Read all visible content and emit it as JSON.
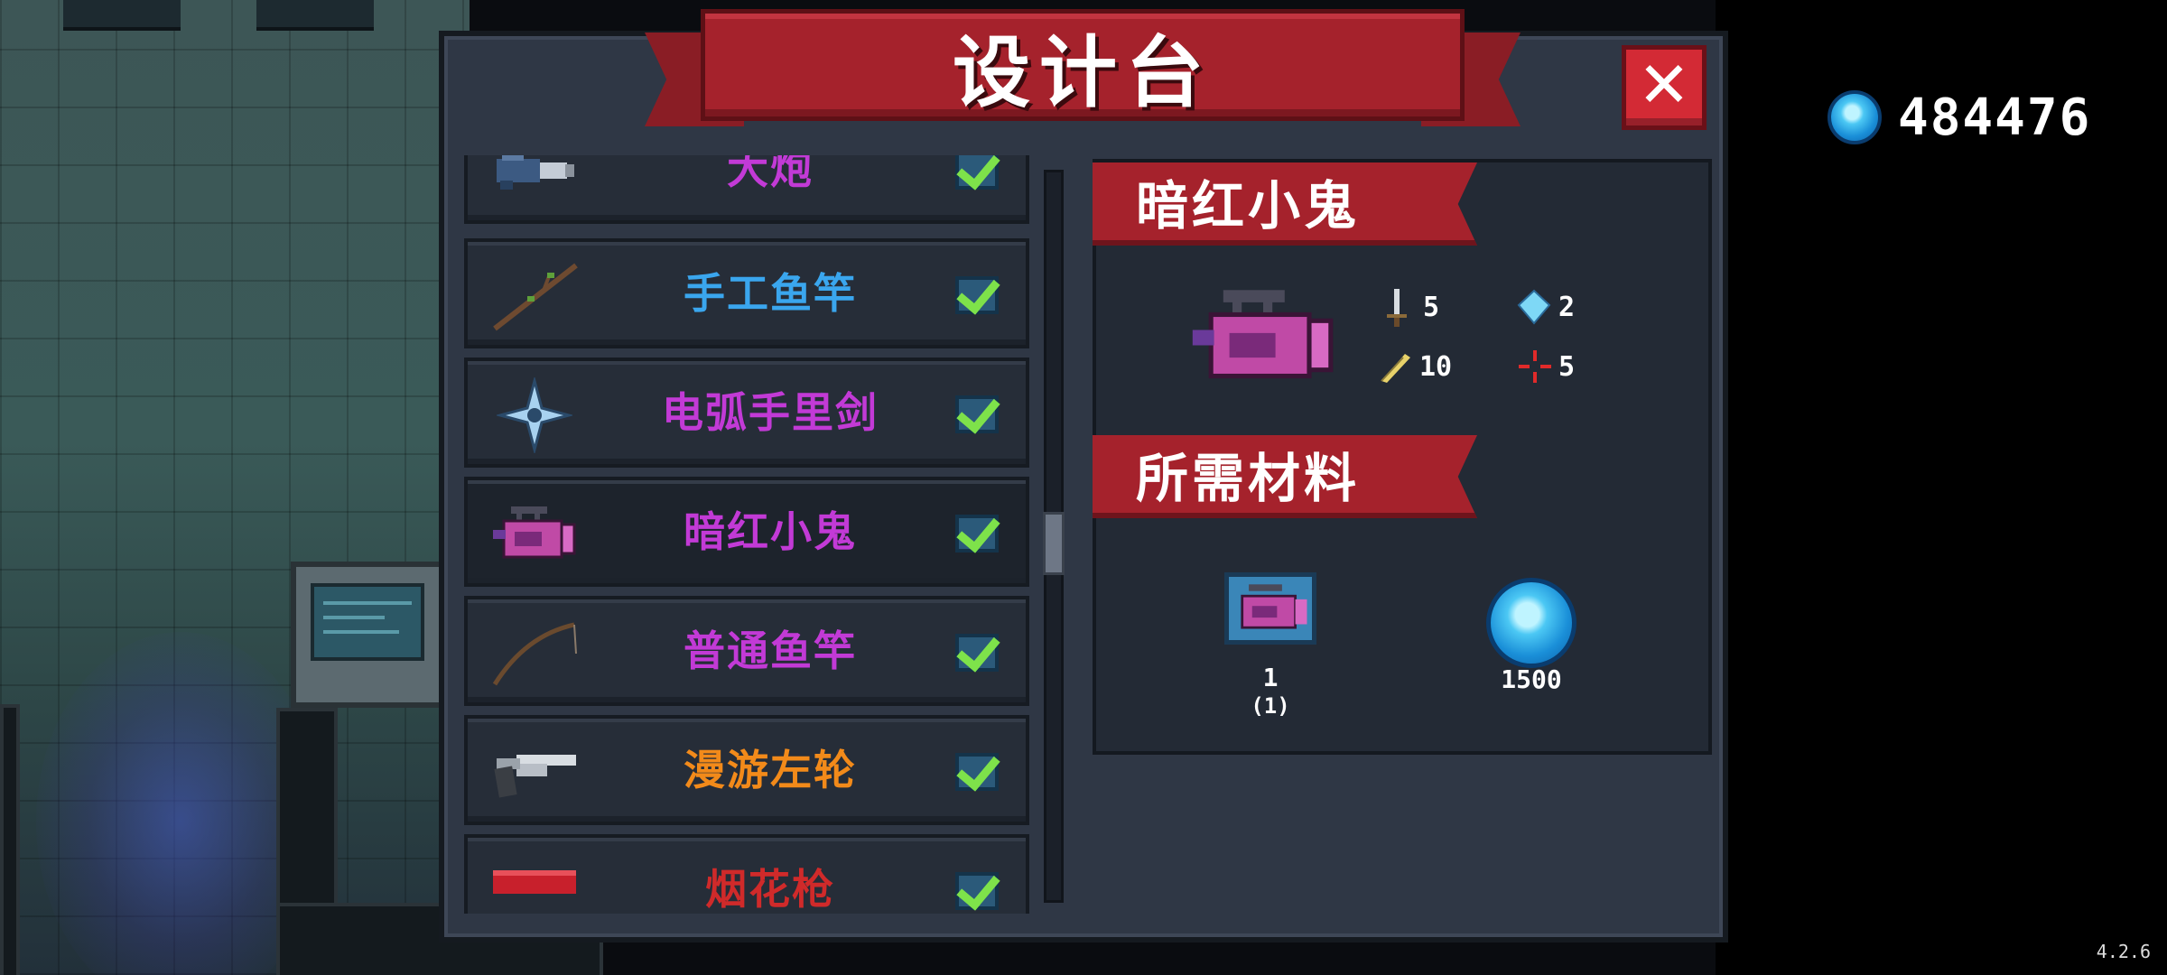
{
  "title": "设计台",
  "close_label": "✕",
  "currency": {
    "icon": "gem-icon",
    "value": "484476"
  },
  "version": "4.2.6",
  "list": {
    "items": [
      {
        "name": "大炮",
        "color": "#c23ad6",
        "icon": "cannon-icon",
        "checked": true
      },
      {
        "name": "手工鱼竿",
        "color": "#3aa6ee",
        "icon": "handmade-rod-icon",
        "checked": true
      },
      {
        "name": "电弧手里剑",
        "color": "#c23ad6",
        "icon": "shuriken-icon",
        "checked": true
      },
      {
        "name": "暗红小鬼",
        "color": "#c23ad6",
        "icon": "crimson-imp-icon",
        "checked": true,
        "selected": true
      },
      {
        "name": "普通鱼竿",
        "color": "#c23ad6",
        "icon": "fishing-rod-icon",
        "checked": true
      },
      {
        "name": "漫游左轮",
        "color": "#f28a1a",
        "icon": "revolver-icon",
        "checked": true
      },
      {
        "name": "烟花枪",
        "color": "#d02a2a",
        "icon": "firework-gun-icon",
        "checked": true
      }
    ]
  },
  "detail": {
    "item_name": "暗红小鬼",
    "stats": {
      "damage": "5",
      "energy": "2",
      "speed": "10",
      "crit": "5"
    },
    "materials_heading": "所需材料",
    "materials": [
      {
        "icon": "blueprint-icon",
        "count": "1",
        "owned": "(1)"
      },
      {
        "icon": "gem-icon",
        "count": "1500"
      }
    ]
  }
}
